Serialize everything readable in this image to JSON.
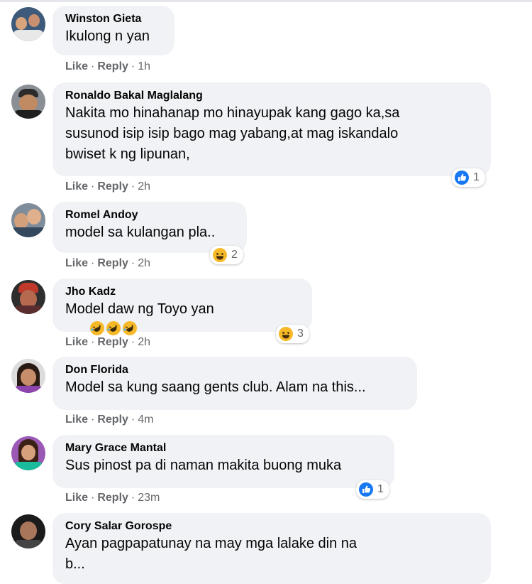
{
  "comments": [
    {
      "author": "Winston Gieta",
      "text": "Ikulong n yan",
      "like": "Like",
      "reply": "Reply",
      "time": "1h",
      "reactions": null
    },
    {
      "author": "Ronaldo Bakal Maglalang",
      "text": "Nakita mo hinahanap mo hinayupak kang gago ka,sa\nsusunod isip isip bago mag yabang,at mag iskandalo\nbwiset k ng lipunan,",
      "like": "Like",
      "reply": "Reply",
      "time": "2h",
      "reactions": {
        "icon": "like-icon",
        "count": "1"
      }
    },
    {
      "author": "Romel Andoy",
      "text": "model sa kulangan pla..",
      "like": "Like",
      "reply": "Reply",
      "time": "2h",
      "reactions": {
        "icon": "haha-icon",
        "count": "2"
      }
    },
    {
      "author": "Jho Kadz",
      "text": "Model daw ng Toyo yan",
      "emoji_suffix": [
        "rofl-emoji",
        "rofl-emoji",
        "rofl-emoji"
      ],
      "like": "Like",
      "reply": "Reply",
      "time": "2h",
      "reactions": {
        "icon": "haha-icon",
        "count": "3"
      }
    },
    {
      "author": "Don Florida",
      "text": "Model sa kung saang gents club. Alam na this...",
      "like": "Like",
      "reply": "Reply",
      "time": "4m",
      "reactions": null
    },
    {
      "author": "Mary Grace Mantal",
      "text": "Sus pinost pa di naman makita buong muka",
      "like": "Like",
      "reply": "Reply",
      "time": "23m",
      "reactions": {
        "icon": "like-icon",
        "count": "1"
      }
    },
    {
      "author": "Cory Salar Gorospe",
      "text": "Ayan pagpapatunay na may mga lalake din na\nb...",
      "like": "",
      "reply": "",
      "time": "",
      "reactions": null
    }
  ],
  "colors": {
    "bubble": "#f0f2f5",
    "secondary_text": "#65676b",
    "like_blue": "#1877f2",
    "haha_yellow": "#f7b928"
  }
}
